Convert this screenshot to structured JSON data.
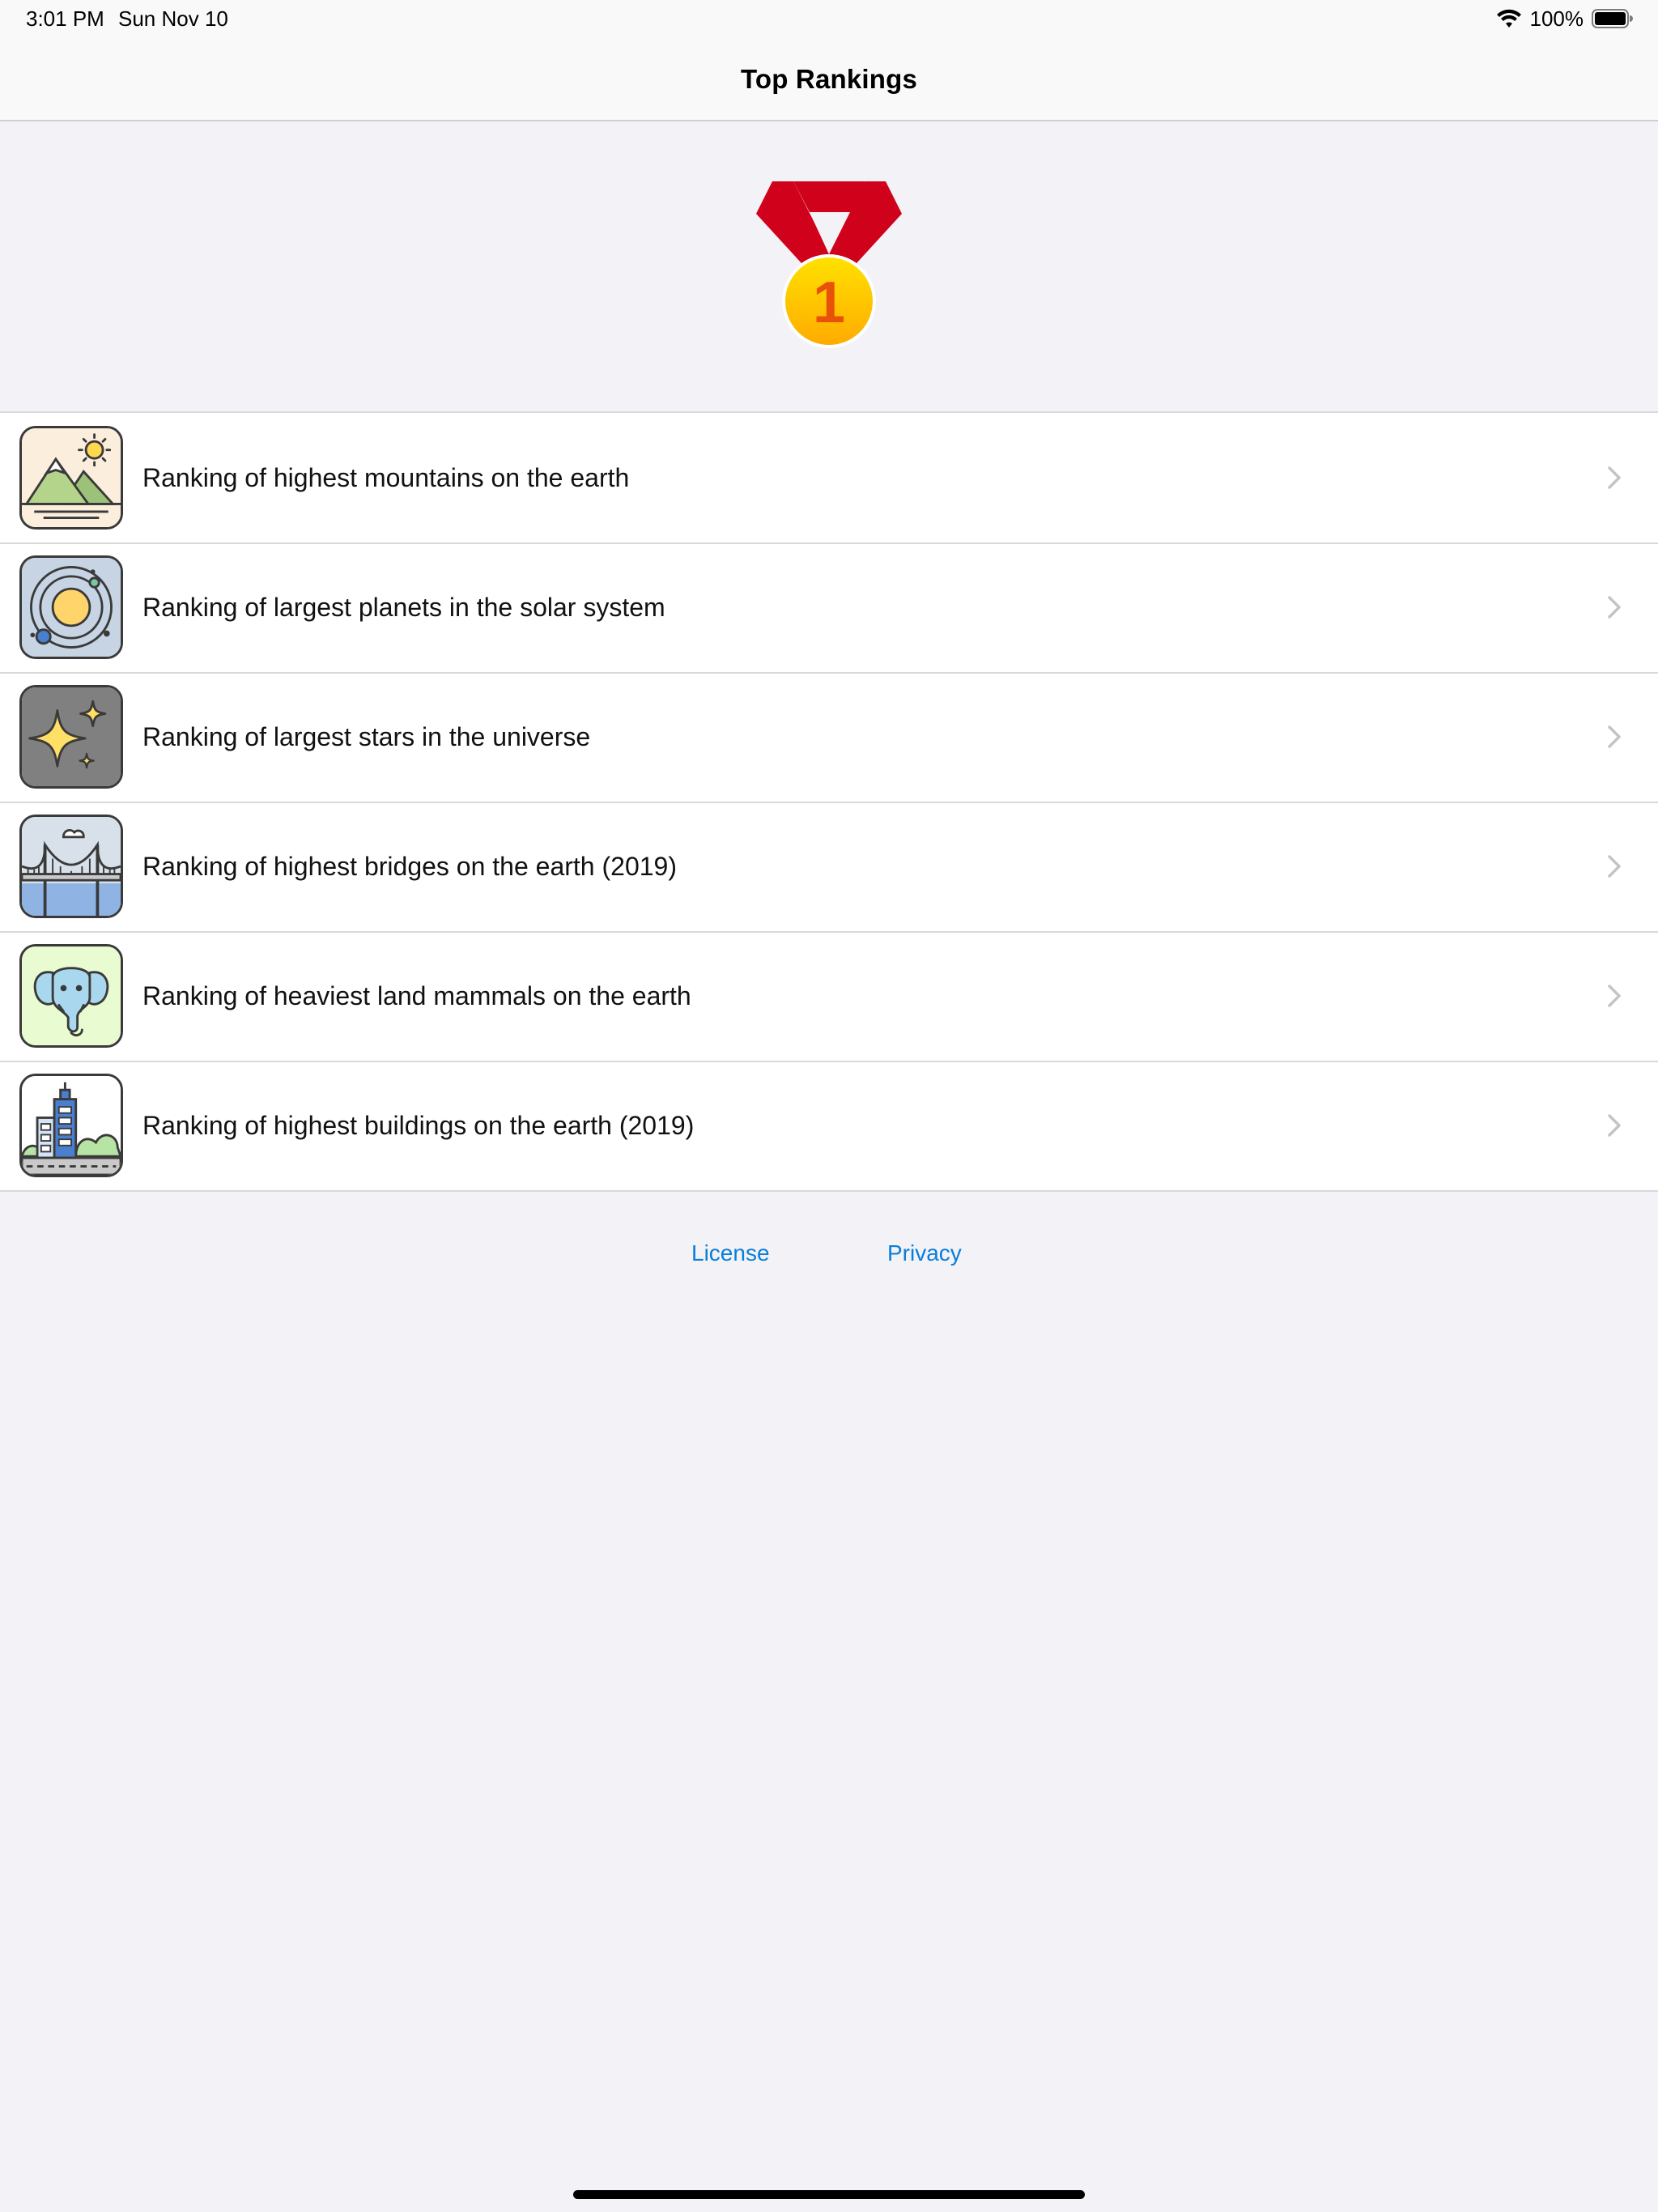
{
  "status_bar": {
    "time": "3:01 PM",
    "date": "Sun Nov 10",
    "battery": "100%"
  },
  "nav": {
    "title": "Top Rankings"
  },
  "header": {
    "medal_number": "1",
    "medal_icon": "gold-medal-icon"
  },
  "rankings": [
    {
      "label": "Ranking of highest mountains on the earth",
      "icon": "mountain-icon"
    },
    {
      "label": "Ranking of largest planets in the solar system",
      "icon": "planet-icon"
    },
    {
      "label": "Ranking of largest stars in the universe",
      "icon": "star-icon"
    },
    {
      "label": "Ranking of highest bridges on the earth (2019)",
      "icon": "bridge-icon"
    },
    {
      "label": "Ranking of heaviest land mammals on the earth",
      "icon": "elephant-icon"
    },
    {
      "label": "Ranking of highest buildings on the earth (2019)",
      "icon": "building-icon"
    }
  ],
  "footer": {
    "license_label": "License",
    "privacy_label": "Privacy"
  },
  "colors": {
    "background": "#f2f2f7",
    "link": "#0a7ed8",
    "ribbon": "#d0021b",
    "medal": "#ffc400"
  }
}
